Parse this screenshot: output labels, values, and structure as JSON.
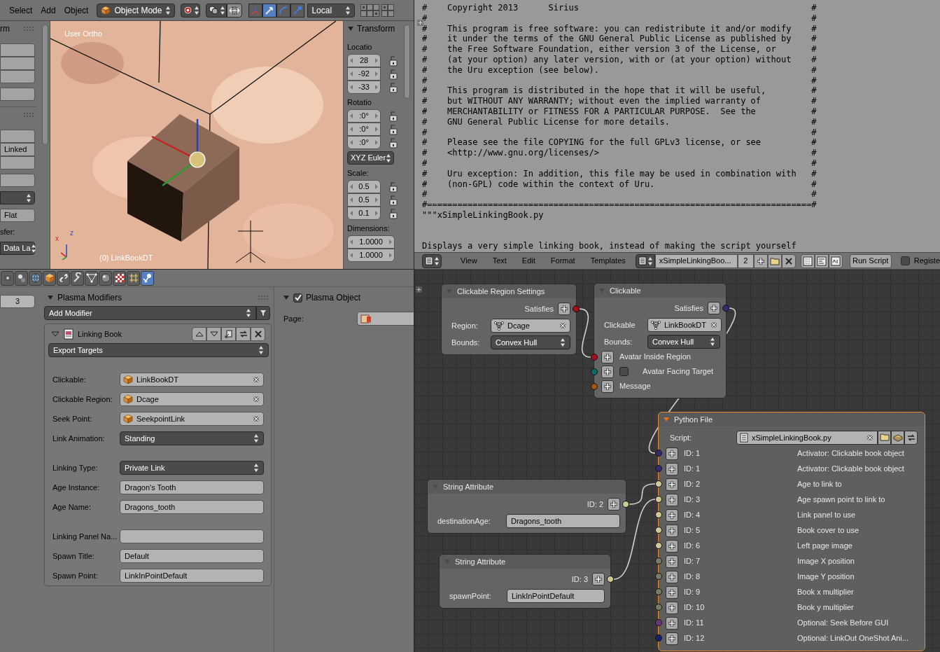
{
  "viewport": {
    "header": {
      "menus": [
        "Select",
        "Add",
        "Object"
      ],
      "mode": "Object Mode",
      "orientation": "Local",
      "manipulators": [
        {
          "selected": false
        },
        {
          "selected": true
        },
        {
          "selected": false
        },
        {
          "selected": false
        }
      ]
    },
    "tool_shelf": {
      "panels": [
        {
          "title": "rm",
          "groups": [
            [
              {
                "kind": "button"
              },
              {
                "kind": "button"
              },
              {
                "kind": "button"
              }
            ],
            [
              {
                "kind": "button"
              }
            ]
          ]
        },
        {
          "groups": [
            [
              {
                "kind": "button"
              },
              {
                "kind": "button",
                "text": "Linked"
              },
              {
                "kind": "button"
              }
            ],
            [
              {
                "kind": "button"
              }
            ],
            [
              {
                "kind": "dropdown"
              }
            ],
            [
              {
                "kind": "button",
                "text": "Flat"
              }
            ],
            [
              {
                "kind": "label",
                "text": "sfer:"
              }
            ],
            [
              {
                "kind": "dropdown",
                "text": "Data La"
              }
            ]
          ]
        }
      ]
    },
    "view_name": "User Ortho",
    "object_label": "(0) LinkBookDT",
    "axis_labels": [
      "x",
      "z"
    ],
    "transform": {
      "title": "Transform",
      "sections": [
        {
          "label": "Locatio",
          "fields": [
            {
              "value": "28",
              "locked": false
            },
            {
              "value": "-92",
              "locked": false
            },
            {
              "value": "-33",
              "locked": false
            }
          ]
        },
        {
          "label": "Rotatio",
          "fields": [
            {
              "value": ":0°",
              "locked": false
            },
            {
              "value": ":0°",
              "locked": false
            },
            {
              "value": ":0°",
              "locked": false
            }
          ],
          "mode": "XYZ Euler"
        },
        {
          "label": "Scale:",
          "fields": [
            {
              "value": "0.5",
              "locked": false
            },
            {
              "value": "0.5",
              "locked": false
            },
            {
              "value": "0.1",
              "locked": false
            }
          ]
        },
        {
          "label": "Dimensions:",
          "fields": [
            {
              "value": "1.0000"
            },
            {
              "value": "1.0000"
            }
          ]
        }
      ]
    }
  },
  "properties": {
    "tabs": [
      {
        "selected": false
      },
      {
        "selected": false
      },
      {
        "selected": false
      },
      {
        "selected": false
      },
      {
        "selected": false
      },
      {
        "selected": false
      },
      {
        "selected": false
      },
      {
        "selected": false
      },
      {
        "selected": false
      },
      {
        "selected": false
      },
      {
        "selected": true
      }
    ],
    "layer_field": "3",
    "modifiers_panel": {
      "title": "Plasma Modifiers",
      "expanded": true,
      "add_label": "Add Modifier",
      "modifier": {
        "title": "Linking Book",
        "expanded": true,
        "target_menu": "Export Targets",
        "groups": [
          [
            {
              "kind": "object",
              "label": "Clickable:",
              "value": "LinkBookDT"
            },
            {
              "kind": "object",
              "label": "Clickable Region:",
              "value": "Dcage"
            },
            {
              "kind": "object",
              "label": "Seek Point:",
              "value": "SeekpointLink"
            },
            {
              "kind": "dropdown",
              "label": "Link Animation:",
              "value": "Standing"
            }
          ],
          [
            {
              "kind": "dropdown",
              "label": "Linking Type:",
              "value": "Private Link"
            },
            {
              "kind": "text",
              "label": "Age Instance:",
              "value": "Dragon's Tooth"
            },
            {
              "kind": "text",
              "label": "Age Name:",
              "value": "Dragons_tooth"
            }
          ],
          [
            {
              "kind": "text",
              "label": "Linking Panel Na..."
            },
            {
              "kind": "text",
              "label": "Spawn Title:",
              "value": "Default"
            },
            {
              "kind": "text",
              "label": "Spawn Point:",
              "value": "LinkInPointDefault"
            }
          ]
        ]
      }
    },
    "object_panel": {
      "title": "Plasma Object",
      "expanded": true,
      "enabled": true,
      "page_label": "Page:"
    }
  },
  "text_editor": {
    "lines": [
      {
        "kind": "code",
        "text": "#    Copyright 2013      Sirius                                              #"
      },
      {
        "kind": "code",
        "text": "#                                                                            #"
      },
      {
        "kind": "code",
        "text": "#    This program is free software: you can redistribute it and/or modify    #"
      },
      {
        "kind": "code",
        "text": "#    it under the terms of the GNU General Public License as published by    #"
      },
      {
        "kind": "code",
        "text": "#    the Free Software Foundation, either version 3 of the License, or       #"
      },
      {
        "kind": "code",
        "text": "#    (at your option) any later version, with or (at your option) without    #"
      },
      {
        "kind": "code",
        "text": "#    the Uru exception (see below).                                          #"
      },
      {
        "kind": "code",
        "text": "#                                                                            #"
      },
      {
        "kind": "code",
        "text": "#    This program is distributed in the hope that it will be useful,         #"
      },
      {
        "kind": "code",
        "text": "#    but WITHOUT ANY WARRANTY; without even the implied warranty of          #"
      },
      {
        "kind": "code",
        "text": "#    MERCHANTABILITY or FITNESS FOR A PARTICULAR PURPOSE.  See the           #"
      },
      {
        "kind": "code",
        "text": "#    GNU General Public License for more details.                            #"
      },
      {
        "kind": "code",
        "text": "#                                                                            #"
      },
      {
        "kind": "code",
        "text": "#    Please see the file COPYING for the full GPLv3 license, or see          #"
      },
      {
        "kind": "code",
        "text": "#    <http://www.gnu.org/licenses/>                                          #"
      },
      {
        "kind": "code",
        "text": "#                                                                            #"
      },
      {
        "kind": "code",
        "text": "#    Uru exception: In addition, this file may be used in combination with   #"
      },
      {
        "kind": "code",
        "text": "#    (non-GPL) code within the context of Uru.                               #"
      },
      {
        "kind": "code",
        "text": "#                                                                            #"
      },
      {
        "kind": "code",
        "text": "#============================================================================#"
      },
      {
        "kind": "code",
        "text": "\"\"\"xSimpleLinkingBook.py"
      },
      {
        "kind": "blank"
      },
      {
        "kind": "blank"
      },
      {
        "kind": "code",
        "text": "Displays a very simple linking book, instead of making the script yourself"
      }
    ],
    "header": {
      "menus": [
        "View",
        "Text",
        "Edit",
        "Format",
        "Templates"
      ],
      "datablock": "xSimpleLinkingBoo...",
      "users": "2",
      "run_label": "Run Script",
      "register": {
        "label": "Registe",
        "checked": false
      }
    }
  },
  "node_editor": {
    "nodes": [
      {
        "title": "Clickable Region Settings",
        "selected": false,
        "output": {
          "label": "Satisfies",
          "color": "#a01018"
        },
        "props": [
          {
            "kind": "object",
            "label": "Region:",
            "value": "Dcage"
          },
          {
            "kind": "dropdown",
            "label": "Bounds:",
            "value": "Convex Hull"
          }
        ]
      },
      {
        "title": "Clickable",
        "selected": false,
        "output": {
          "label": "Satisfies",
          "color": "#3b2870"
        },
        "props": [
          {
            "kind": "object",
            "label": "Clickable",
            "value": "LinkBookDT"
          },
          {
            "kind": "dropdown",
            "label": "Bounds:",
            "value": "Convex Hull"
          }
        ],
        "inputs": [
          {
            "kind": "socket",
            "label": "Avatar Inside Region",
            "color": "#a01020"
          },
          {
            "kind": "toggle",
            "label": "Avatar Facing Target",
            "color": "#0f6a66",
            "checked": false
          },
          {
            "kind": "socket",
            "label": "Message",
            "color": "#a0561a"
          }
        ]
      },
      {
        "title": "Python File",
        "selected": true,
        "script": {
          "label": "Script:",
          "value": "xSimpleLinkingBook.py"
        },
        "inputs": [
          {
            "kind": "socket",
            "label": "ID: 1",
            "description": "Activator: Clickable book object",
            "color": "#3b2870"
          },
          {
            "kind": "socket",
            "label": "ID: 1",
            "description": "Activator: Clickable book object",
            "color": "#3b2870"
          },
          {
            "kind": "socket",
            "label": "ID: 2",
            "description": "Age to link to",
            "color": "#cfc897"
          },
          {
            "kind": "socket",
            "label": "ID: 3",
            "description": "Age spawn point to link to",
            "color": "#cfc897"
          },
          {
            "kind": "socket",
            "label": "ID: 4",
            "description": "Link panel to use",
            "color": "#cfc897"
          },
          {
            "kind": "socket",
            "label": "ID: 5",
            "description": "Book cover to use",
            "color": "#cfc897"
          },
          {
            "kind": "socket",
            "label": "ID: 6",
            "description": "Left page image",
            "color": "#cfc897"
          },
          {
            "kind": "socket",
            "label": "ID: 7",
            "description": "Image X position",
            "color": "#7d7b66"
          },
          {
            "kind": "socket",
            "label": "ID: 8",
            "description": "Image Y position",
            "color": "#7d7b66"
          },
          {
            "kind": "socket",
            "label": "ID: 9",
            "description": "Book x multiplier",
            "color": "#7d7b66"
          },
          {
            "kind": "socket",
            "label": "ID: 10",
            "description": "Book y multiplier",
            "color": "#7d7b66"
          },
          {
            "kind": "socket",
            "label": "ID: 11",
            "description": "Optional: Seek Before GUI",
            "color": "#6a3a78"
          },
          {
            "kind": "socket",
            "label": "ID: 12",
            "description": "Optional: LinkOut OneShot Ani...",
            "color": "#15206a"
          }
        ]
      },
      {
        "title": "String Attribute",
        "selected": false,
        "output": {
          "label": "ID: 2",
          "color": "#cfc897"
        },
        "props": [
          {
            "kind": "text",
            "label": "destinationAge:",
            "value": "Dragons_tooth"
          }
        ]
      },
      {
        "title": "String Attribute",
        "selected": false,
        "output": {
          "label": "ID: 3",
          "color": "#cfc897"
        },
        "props": [
          {
            "kind": "text",
            "label": "spawnPoint:",
            "value": "LinkInPointDefault"
          }
        ]
      }
    ]
  }
}
